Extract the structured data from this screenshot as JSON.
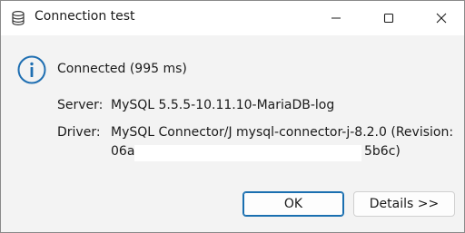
{
  "window": {
    "title": "Connection test",
    "title_icon": "database-icon",
    "controls": {
      "minimize": "minimize-icon",
      "maximize": "maximize-icon",
      "close": "close-icon"
    }
  },
  "message": {
    "icon": "info-icon",
    "status": "Connected (995 ms)"
  },
  "details": {
    "server_label": "Server:",
    "server_value": "MySQL 5.5.5-10.11.10-MariaDB-log",
    "driver_label": "Driver:",
    "driver_value_line1": "MySQL Connector/J mysql-connector-j-8.2.0 (Revision:",
    "driver_revision_start": "06a",
    "driver_revision_end": "5b6c)"
  },
  "buttons": {
    "ok": "OK",
    "details": "Details >>"
  },
  "colors": {
    "accent": "#1a6fb0",
    "info_icon": "#1f6fb2",
    "background": "#f3f3f3"
  }
}
